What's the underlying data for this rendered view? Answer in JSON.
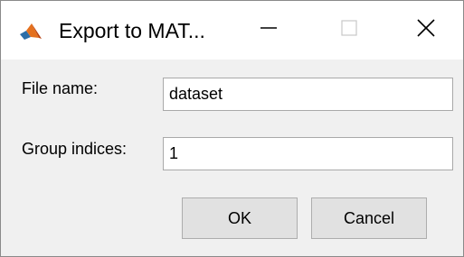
{
  "window": {
    "title": "Export to MAT...",
    "icon": "matlab-logo-icon",
    "controls": [
      "minimize-icon",
      "maximize-icon",
      "close-icon"
    ]
  },
  "form": {
    "file_name_label": "File name:",
    "file_name_value": "dataset",
    "group_indices_label": "Group indices:",
    "group_indices_value": "1"
  },
  "buttons": {
    "ok": "OK",
    "cancel": "Cancel"
  },
  "colors": {
    "titlebar": "#ffffff",
    "dialog_bg": "#f0f0f0",
    "button_bg": "#e1e1e1"
  }
}
